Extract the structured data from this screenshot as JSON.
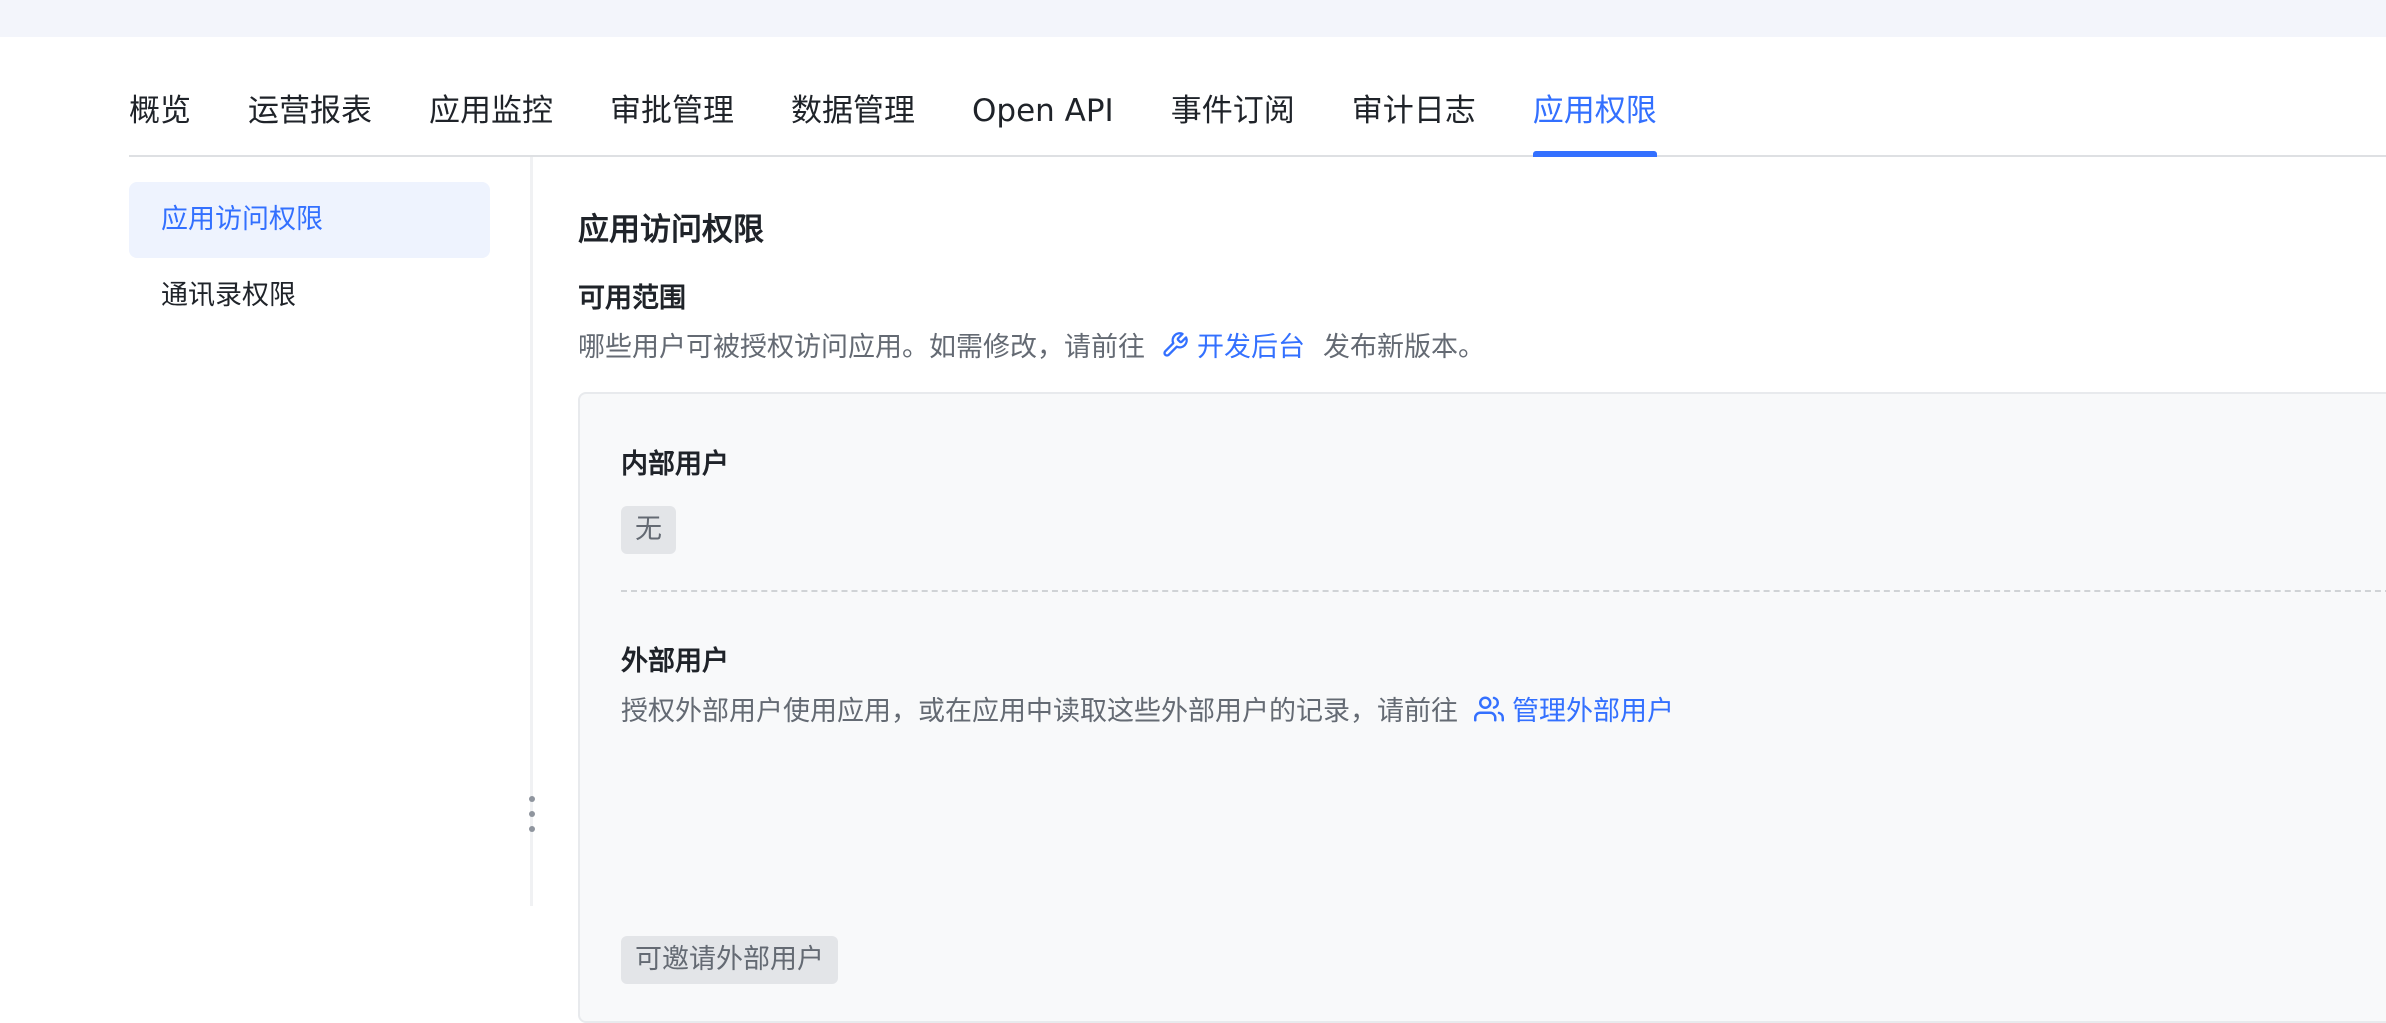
{
  "tabs": [
    {
      "label": "概览"
    },
    {
      "label": "运营报表"
    },
    {
      "label": "应用监控"
    },
    {
      "label": "审批管理"
    },
    {
      "label": "数据管理"
    },
    {
      "label": "Open API"
    },
    {
      "label": "事件订阅"
    },
    {
      "label": "审计日志"
    },
    {
      "label": "应用权限",
      "active": true
    }
  ],
  "sidebar": {
    "items": [
      {
        "label": "应用访问权限",
        "active": true
      },
      {
        "label": "通讯录权限"
      }
    ]
  },
  "main": {
    "title": "应用访问权限",
    "scope": {
      "title": "可用范围",
      "desc_before": "哪些用户可被授权访问应用。如需修改，请前往",
      "link_label": "开发后台",
      "link_icon": "wrench-icon",
      "desc_after": "发布新版本。"
    },
    "internal": {
      "title": "内部用户",
      "tag": "无"
    },
    "external": {
      "title": "外部用户",
      "desc": "授权外部用户使用应用，或在应用中读取这些外部用户的记录，请前往",
      "link_label": "管理外部用户",
      "link_icon": "users-icon",
      "tag": "可邀请外部用户"
    }
  },
  "colors": {
    "accent": "#3370ff",
    "text": "#1f2329",
    "secondary_text": "#646a73",
    "card_bg": "#f8f9fa"
  }
}
